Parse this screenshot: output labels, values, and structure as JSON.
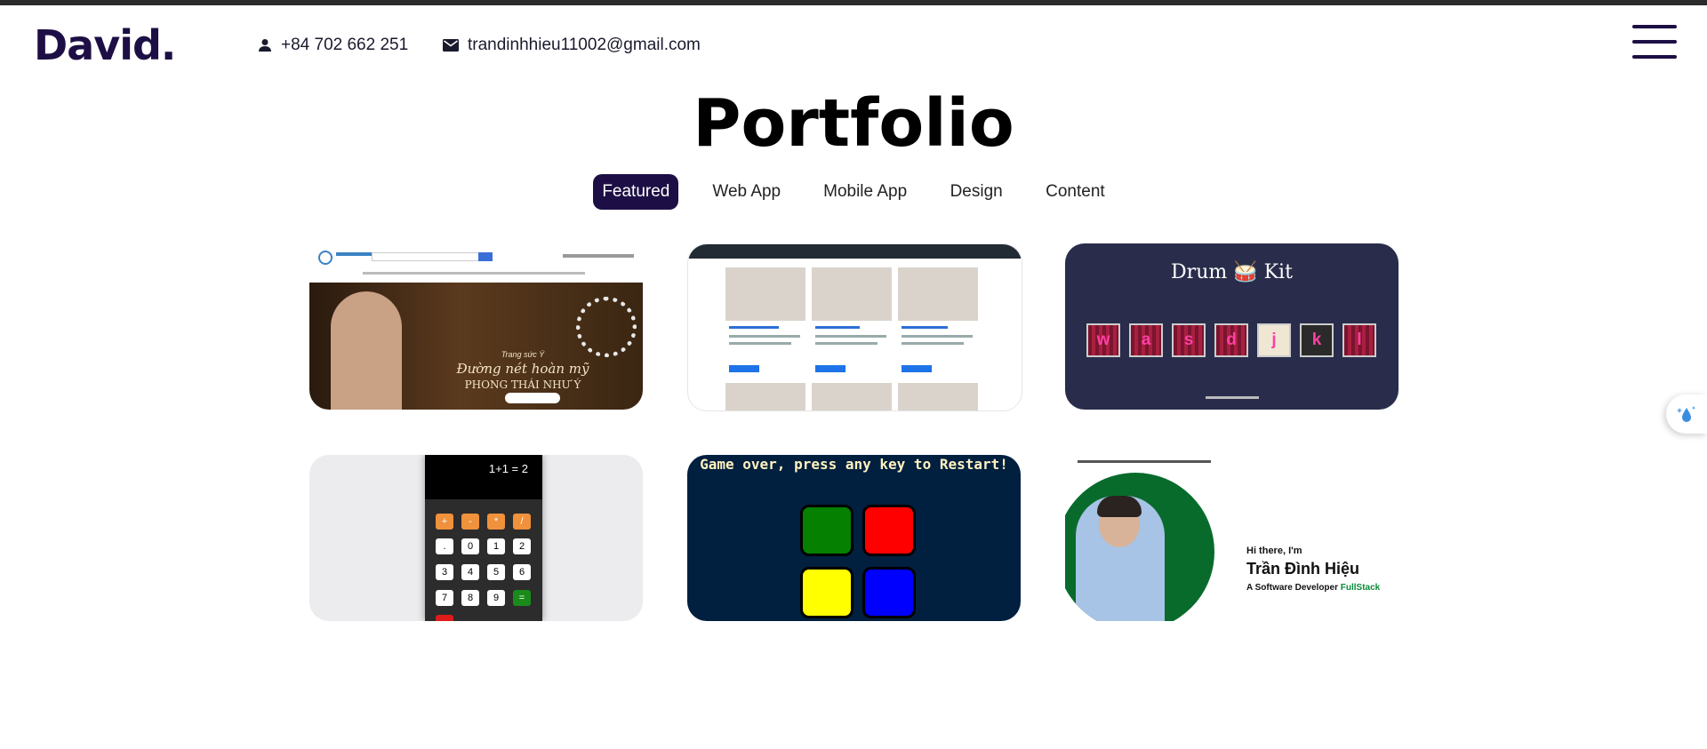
{
  "brand": {
    "logo": "David."
  },
  "contact": {
    "phone": "+84 702 662 251",
    "email": "trandinhhieu11002@gmail.com"
  },
  "page": {
    "title": "Portfolio"
  },
  "tabs": [
    {
      "label": "Featured",
      "active": true
    },
    {
      "label": "Web App",
      "active": false
    },
    {
      "label": "Mobile App",
      "active": false
    },
    {
      "label": "Design",
      "active": false
    },
    {
      "label": "Content",
      "active": false
    }
  ],
  "projects": {
    "jewelry": {
      "caption_small": "Trang sức Ý",
      "caption_script": "Đường nét hoàn mỹ",
      "caption_main": "PHONG THÁI NHƯ Ý"
    },
    "drum": {
      "title": "Drum 🥁 Kit",
      "keys": [
        "w",
        "a",
        "s",
        "d",
        "j",
        "k",
        "l"
      ]
    },
    "calculator": {
      "display": "1+1 = 2",
      "keys": [
        "+",
        "-",
        "*",
        "/",
        ".",
        "0",
        "1",
        "2",
        "3",
        "4",
        "5",
        "6",
        "7",
        "8",
        "9",
        "="
      ]
    },
    "simon": {
      "message": "Game over, press any key to Restart!"
    },
    "profile": {
      "greeting": "Hi there, I'm",
      "name": "Trần Đình Hiệu",
      "role_prefix": "A Software Developer",
      "role_highlight": "FullStack",
      "highlight_color": "#0a8a3a"
    }
  },
  "colors": {
    "brand": "#1d0f45"
  }
}
